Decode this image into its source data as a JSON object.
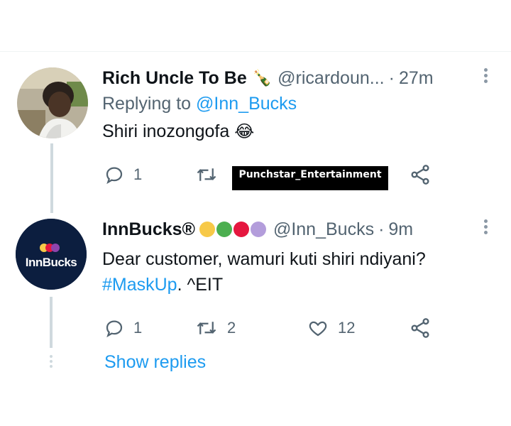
{
  "tweet1": {
    "name": "Rich Uncle To Be",
    "name_emoji": "🍾",
    "handle": "@ricardoun...",
    "separator": "·",
    "time": "27m",
    "replying_prefix": "Replying to",
    "replying_handle": "@Inn_Bucks",
    "text": "Shiri inozongofa",
    "text_emoji": "😂",
    "replies": "1"
  },
  "watermark": "Punchstar_Entertainment",
  "tweet2": {
    "name": "InnBucks®",
    "handle": "@Inn_Bucks",
    "separator": "·",
    "time": "9m",
    "avatar_text": "InnBucks",
    "text": "Dear customer, wamuri kuti shiri ndiyani?",
    "hashtag": "#MaskUp",
    "signature": ". ^EIT",
    "replies": "1",
    "retweets": "2",
    "likes": "12",
    "badge_colors": [
      "#f7c948",
      "#4caf50",
      "#e5173f",
      "#b39ddb"
    ]
  },
  "show_replies": "Show replies",
  "colors": {
    "link": "#1d9bf0",
    "muted": "#536471",
    "avatar_bg": "#0c1e3f"
  },
  "icons": [
    "reply-icon",
    "retweet-icon",
    "like-icon",
    "share-icon",
    "more-icon"
  ]
}
